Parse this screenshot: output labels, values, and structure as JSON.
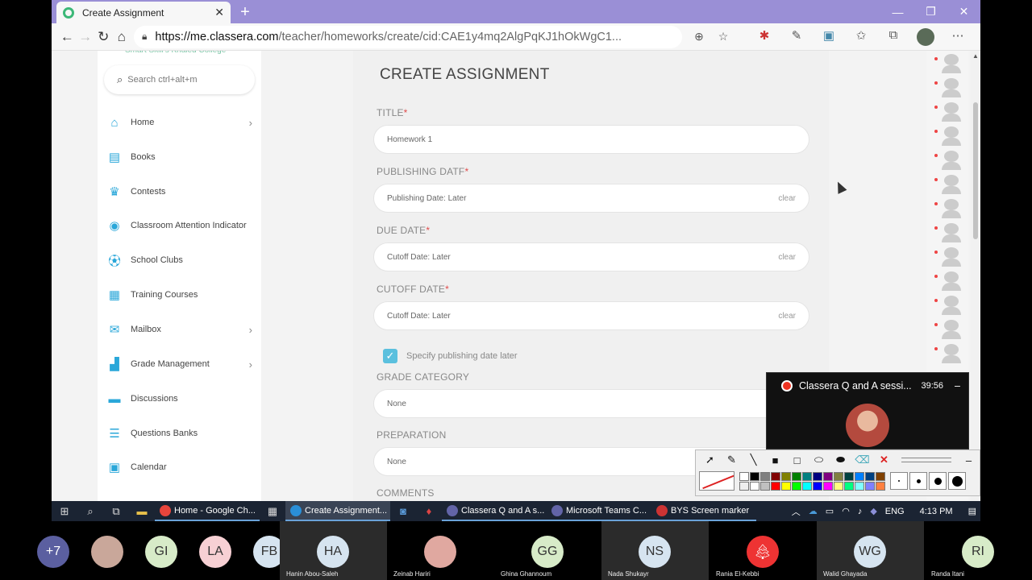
{
  "browser": {
    "tab_title": "Create Assignment",
    "url_host": "https://me.classera.com",
    "url_path": "/teacher/homeworks/create/cid:CAE1y4mq2AlgPqKJ1hOkWgC1..."
  },
  "sidebar": {
    "brand": "Smart Skill's Khaled College",
    "search_placeholder": "Search  ctrl+alt+m",
    "items": [
      {
        "label": "Home",
        "icon": "home-icon",
        "arrow": "›"
      },
      {
        "label": "Books",
        "icon": "book-icon",
        "arrow": ""
      },
      {
        "label": "Contests",
        "icon": "trophy-icon",
        "arrow": ""
      },
      {
        "label": "Classroom Attention Indicator",
        "icon": "eye-icon",
        "arrow": ""
      },
      {
        "label": "School Clubs",
        "icon": "ball-icon",
        "arrow": ""
      },
      {
        "label": "Training Courses",
        "icon": "grid-icon",
        "arrow": ""
      },
      {
        "label": "Mailbox",
        "icon": "mail-icon",
        "arrow": "›"
      },
      {
        "label": "Grade Management",
        "icon": "chart-icon",
        "arrow": "›"
      },
      {
        "label": "Discussions",
        "icon": "chat-icon",
        "arrow": ""
      },
      {
        "label": "Questions Banks",
        "icon": "list-icon",
        "arrow": ""
      },
      {
        "label": "Calendar",
        "icon": "calendar-icon",
        "arrow": ""
      }
    ]
  },
  "form": {
    "heading": "CREATE ASSIGNMENT",
    "title_label": "TITLE",
    "title_value": "Homework 1",
    "publishing_label": "PUBLISHING DATF",
    "publishing_value": "Publishing Date: Later",
    "due_label": "DUE DATE",
    "due_value": "Cutoff Date: Later",
    "cutoff_label": "CUTOFF DATE",
    "cutoff_value": "Cutoff Date: Later",
    "clear": "clear",
    "required_mark": "*",
    "checkbox_label": "Specify publishing date later",
    "grade_label": "GRADE CATEGORY",
    "grade_value": "None",
    "prep_label": "PREPARATION",
    "prep_value": "None",
    "comments_label": "COMMENTS"
  },
  "meeting": {
    "title": "Classera Q and A sessi...",
    "time": "39:56",
    "min": "–"
  },
  "taskbar": {
    "apps": [
      {
        "label": "Home - Google Ch...",
        "color": "#e8453c"
      },
      {
        "label": "Create Assignment...",
        "color": "#2a8fd8"
      },
      {
        "label": "Classera Q and A s...",
        "color": "#6264a7"
      },
      {
        "label": "Microsoft Teams C...",
        "color": "#6264a7"
      },
      {
        "label": "BYS Screen marker",
        "color": "#c33"
      }
    ],
    "lang": "ENG",
    "time": "4:13 PM"
  },
  "participants": [
    {
      "initials": "+7",
      "name": "",
      "bg": "#5b5fa0",
      "fg": "#fff"
    },
    {
      "initials": "",
      "name": "",
      "bg": "#c9a79a",
      "fg": "#333"
    },
    {
      "initials": "GI",
      "name": "",
      "bg": "#d7ebc8",
      "fg": "#333"
    },
    {
      "initials": "LA",
      "name": "",
      "bg": "#f7d0d4",
      "fg": "#333"
    },
    {
      "initials": "FB",
      "name": "",
      "bg": "#d6e4f0",
      "fg": "#333"
    },
    {
      "initials": "HA",
      "name": "Hanin Abou-Saleh",
      "bg": "#d6e4f0",
      "fg": "#333"
    },
    {
      "initials": "",
      "name": "Zeinab Hariri",
      "bg": "#e0a8a0",
      "fg": "#333"
    },
    {
      "initials": "GG",
      "name": "Ghina Ghannoum",
      "bg": "#d7ebc8",
      "fg": "#333"
    },
    {
      "initials": "NS",
      "name": "Nada Shukayr",
      "bg": "#d6e4f0",
      "fg": "#333"
    },
    {
      "initials": "",
      "name": "Rania El-Kebbi",
      "bg": "#e33",
      "fg": "#fff"
    },
    {
      "initials": "WG",
      "name": "Walid Ghayada",
      "bg": "#d6e4f0",
      "fg": "#333"
    },
    {
      "initials": "RI",
      "name": "Randa Itani",
      "bg": "#d7ebc8",
      "fg": "#333"
    }
  ]
}
